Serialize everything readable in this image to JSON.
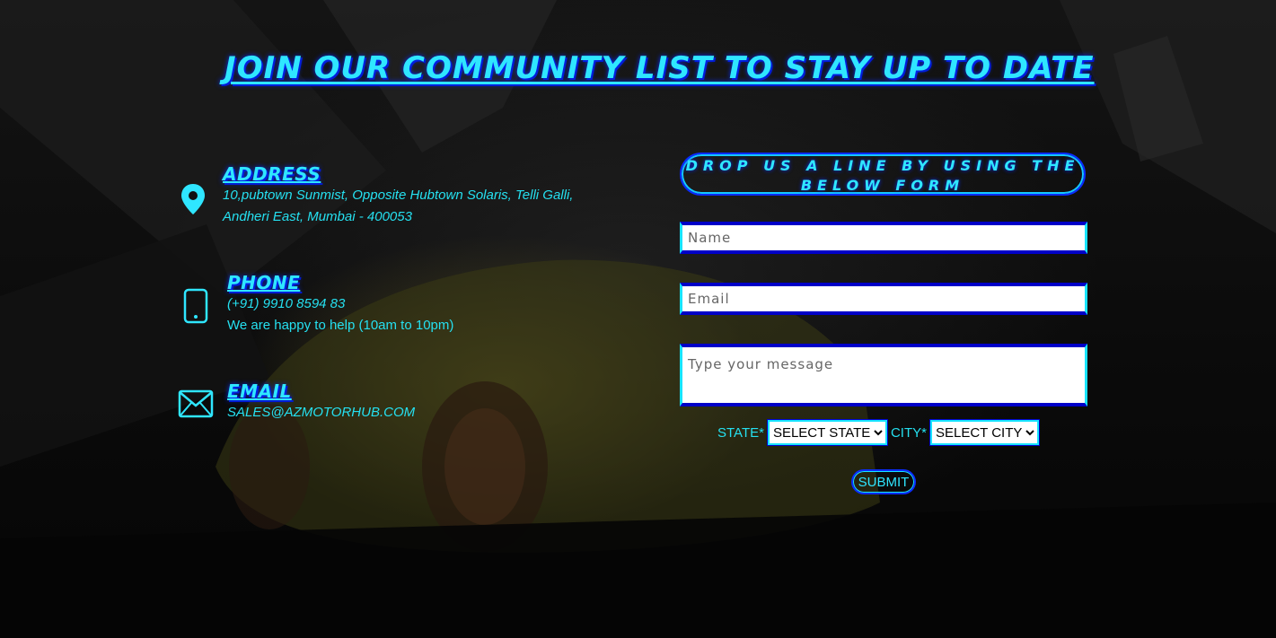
{
  "page": {
    "title": "JOIN OUR COMMUNITY LIST TO STAY UP TO DATE"
  },
  "contact": {
    "address": {
      "heading": "ADDRESS",
      "line1": "10,pubtown Sunmist, Opposite Hubtown Solaris, Telli Galli,",
      "line2": "Andheri East, Mumbai - 400053",
      "icon": "map-pin-icon"
    },
    "phone": {
      "heading": "PHONE",
      "number": "(+91) 9910 8594 83",
      "hours": "We are happy to help (10am to 10pm)",
      "icon": "phone-icon"
    },
    "email": {
      "heading": "EMAIL",
      "value": "SALES@AZMOTORHUB.COM",
      "icon": "envelope-icon"
    }
  },
  "form": {
    "heading": "DROP US A LINE BY USING THE BELOW FORM",
    "name_placeholder": "Name",
    "email_placeholder": "Email",
    "message_placeholder": "Type your message",
    "state_label": "STATE*",
    "state_selected": "SELECT STATE",
    "city_label": "CITY*",
    "city_selected": "SELECT CITY",
    "submit_label": "SUBMIT"
  },
  "colors": {
    "accent": "#2fe6ff",
    "shadow": "#0a2cff",
    "background": "#050505"
  }
}
